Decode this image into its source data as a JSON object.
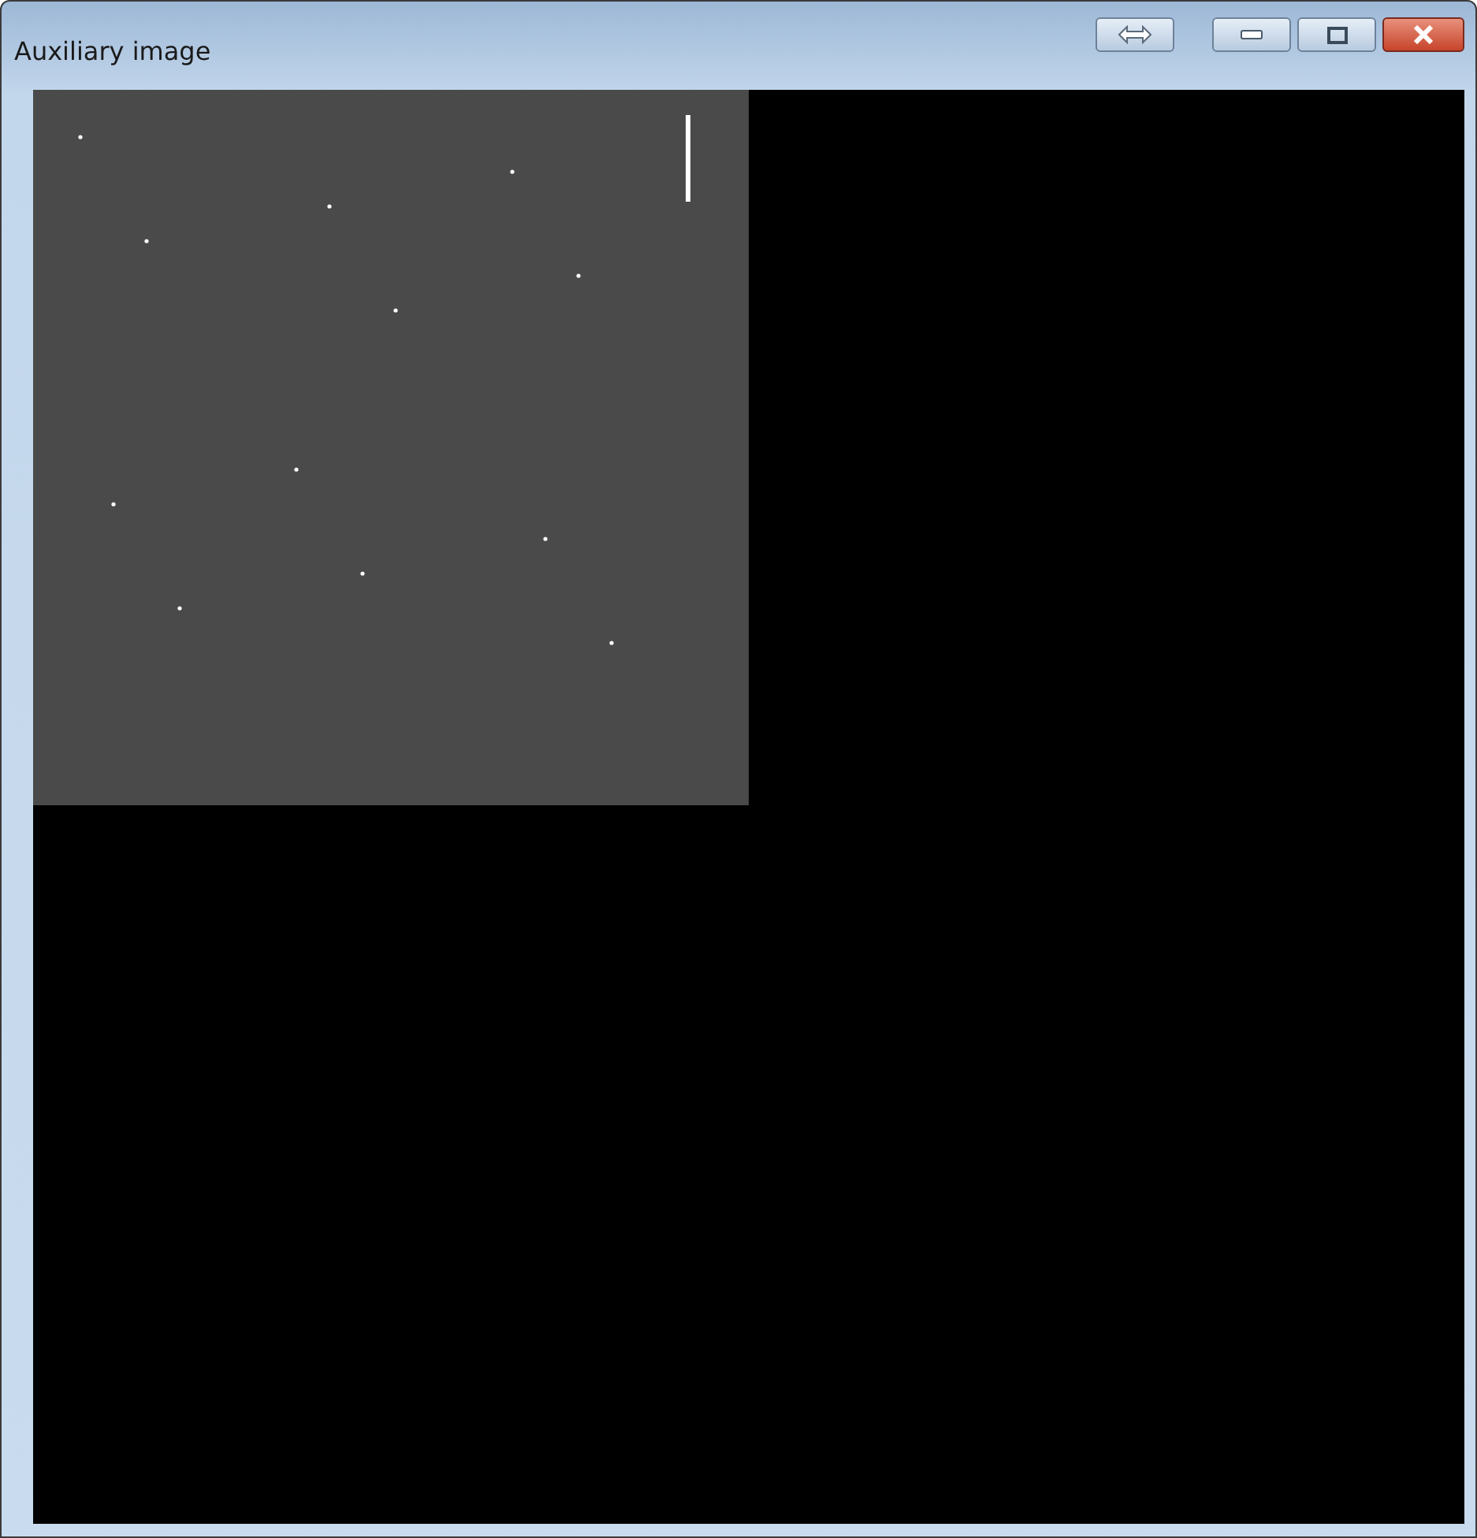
{
  "window": {
    "title": "Auxiliary image"
  }
}
